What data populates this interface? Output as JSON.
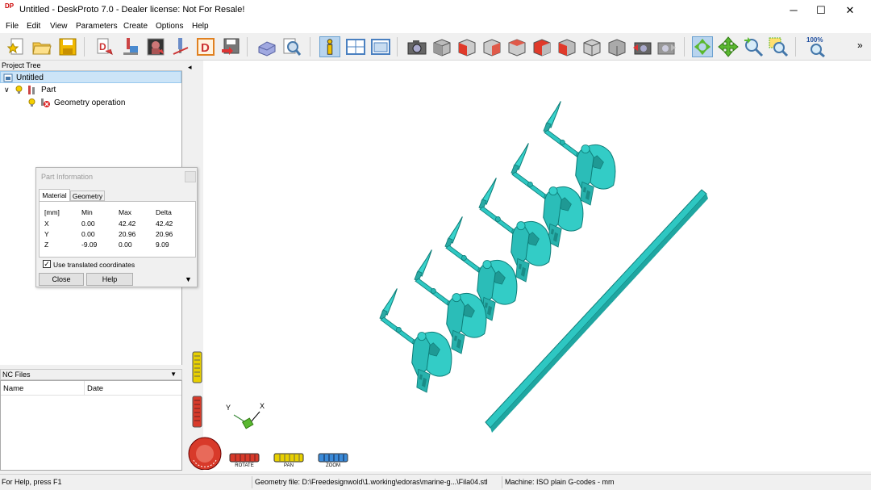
{
  "window": {
    "title": "Untitled - DeskProto 7.0 - Dealer license: Not For Resale!",
    "app_icon_text": "DP",
    "minimize_glyph": "─",
    "maximize_glyph": "☐",
    "close_glyph": "✕"
  },
  "menu": [
    "File",
    "Edit",
    "View",
    "Parameters",
    "Create",
    "Options",
    "Help"
  ],
  "toolbar": {
    "zoom_percent": "100%",
    "overflow_glyph": "»",
    "accent_teal": "#2bc4c4",
    "active_blue": "#a8c8e8"
  },
  "project_tree": {
    "header": "Project Tree",
    "root": "Untitled",
    "part": "Part",
    "operation": "Geometry operation",
    "expand_glyph": "∨"
  },
  "nc_files": {
    "header": "NC Files",
    "dropdown_glyph": "▼",
    "col_name": "Name",
    "col_date": "Date"
  },
  "part_info": {
    "title": "Part Information",
    "tab_material": "Material",
    "tab_geometry": "Geometry",
    "headers": [
      "[mm]",
      "Min",
      "Max",
      "Delta"
    ],
    "rows": [
      [
        "X",
        "0.00",
        "42.42",
        "42.42"
      ],
      [
        "Y",
        "0.00",
        "20.96",
        "20.96"
      ],
      [
        "Z",
        "-9.09",
        "0.00",
        "9.09"
      ]
    ],
    "checkbox_label": "Use translated coordinates",
    "checkbox_checked": true,
    "close_label": "Close",
    "help_label": "Help",
    "arrow_glyph": "▼"
  },
  "viewport": {
    "collapse_glyph": "◂",
    "model_color": "#2ec7c2",
    "axis_y": "Y",
    "axis_x": "X",
    "rotate_label": "ROTATE",
    "pan_label": "PAN",
    "zoom_label": "ZOOM"
  },
  "status": {
    "help": "For Help, press F1",
    "geometry_file": "Geometry file: D:\\Freedesignwold\\1.working\\edoras\\marine-g...\\Fila04.stl",
    "machine": "Machine: ISO plain G-codes - mm"
  }
}
